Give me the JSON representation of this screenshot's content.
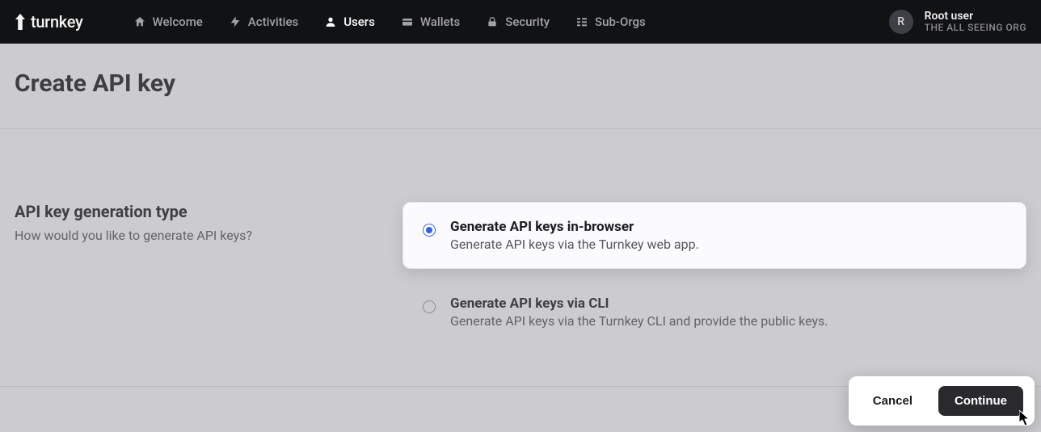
{
  "brand": "turnkey",
  "nav": [
    {
      "id": "welcome",
      "label": "Welcome",
      "active": false,
      "icon": "home-icon"
    },
    {
      "id": "activities",
      "label": "Activities",
      "active": false,
      "icon": "bolt-icon"
    },
    {
      "id": "users",
      "label": "Users",
      "active": true,
      "icon": "user-icon"
    },
    {
      "id": "wallets",
      "label": "Wallets",
      "active": false,
      "icon": "wallet-icon"
    },
    {
      "id": "security",
      "label": "Security",
      "active": false,
      "icon": "lock-icon"
    },
    {
      "id": "suborgs",
      "label": "Sub-Orgs",
      "active": false,
      "icon": "suborgs-icon"
    }
  ],
  "user": {
    "initial": "R",
    "name": "Root user",
    "org": "THE ALL SEEING ORG"
  },
  "page": {
    "title": "Create API key"
  },
  "section": {
    "heading": "API key generation type",
    "subheading": "How would you like to generate API keys?"
  },
  "options": [
    {
      "id": "in-browser",
      "title": "Generate API keys in-browser",
      "desc": "Generate API keys via the Turnkey web app.",
      "selected": true
    },
    {
      "id": "via-cli",
      "title": "Generate API keys via CLI",
      "desc": "Generate API keys via the Turnkey CLI and provide the public keys.",
      "selected": false
    }
  ],
  "actions": {
    "cancel": "Cancel",
    "continue": "Continue"
  }
}
